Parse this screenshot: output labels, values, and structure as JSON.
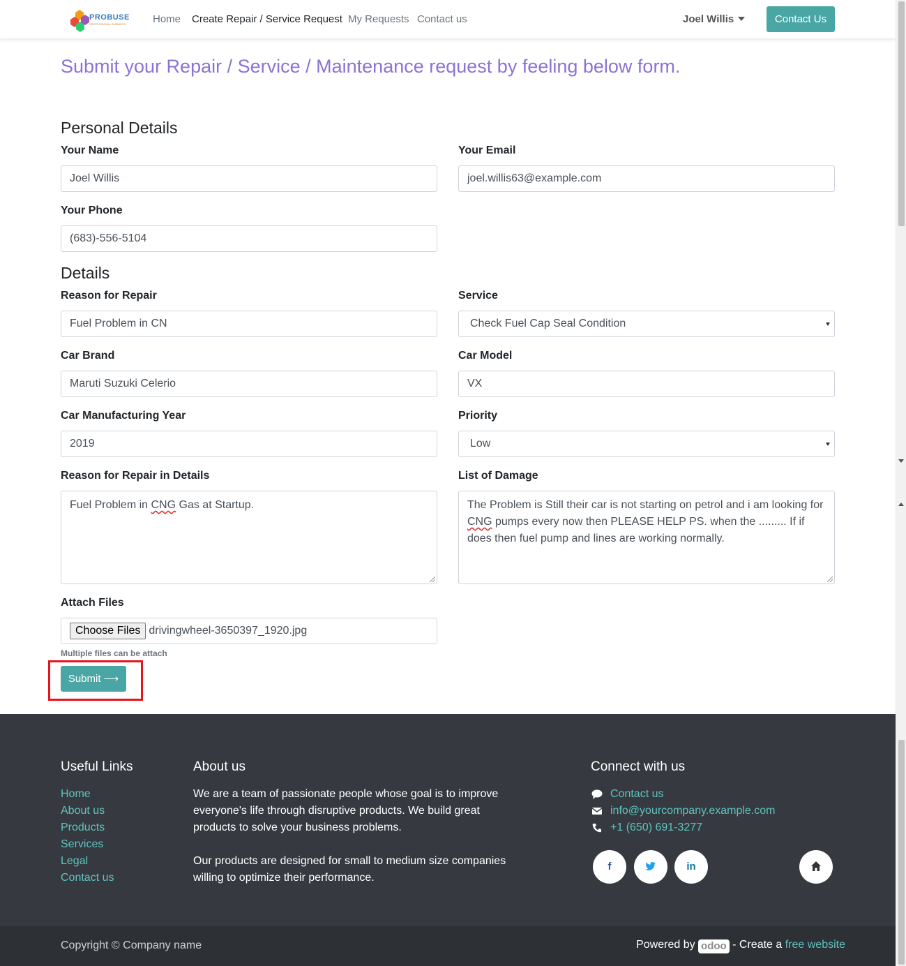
{
  "header": {
    "brand": "PROBUSE",
    "brand_tagline": "PROFESSIONAL BUSINESS",
    "nav": [
      "Home",
      "Create Repair / Service Request",
      "My Requests",
      "Contact us"
    ],
    "user_name": "Joel Willis",
    "contact_button": "Contact Us"
  },
  "main": {
    "title": "Submit your Repair / Service / Maintenance request by feeling below form.",
    "personal_section": "Personal Details",
    "details_section": "Details",
    "fields": {
      "name": {
        "label": "Your Name",
        "value": "Joel Willis"
      },
      "email": {
        "label": "Your Email",
        "value": "joel.willis63@example.com"
      },
      "phone": {
        "label": "Your Phone",
        "value": "(683)-556-5104"
      },
      "reason": {
        "label": "Reason for Repair",
        "value": "Fuel Problem in CN"
      },
      "service": {
        "label": "Service",
        "value": "Check Fuel Cap Seal Condition"
      },
      "brand": {
        "label": "Car Brand",
        "value": "Maruti Suzuki Celerio"
      },
      "model": {
        "label": "Car Model",
        "value": "VX"
      },
      "year": {
        "label": "Car Manufacturing Year",
        "value": "2019"
      },
      "priority": {
        "label": "Priority",
        "value": "Low"
      },
      "reason_details": {
        "label": "Reason for Repair in Details",
        "text_before": "Fuel Problem in ",
        "misspelled": "CNG",
        "text_after": " Gas at Startup."
      },
      "damage": {
        "label": "List of Damage",
        "text_before": "The Problem is Still their car is not starting on petrol and i am looking for ",
        "misspelled": "CNG",
        "text_after": " pumps every now then PLEASE HELP PS. when the ......... If if does then fuel pump and lines are working normally."
      },
      "attach": {
        "label": "Attach Files",
        "button": "Choose Files",
        "file": "drivingwheel-3650397_1920.jpg",
        "help": "Multiple files can be attach"
      }
    },
    "submit_label": "Submit",
    "submit_arrow": "⟶"
  },
  "footer": {
    "useful_links_title": "Useful Links",
    "useful_links": [
      "Home",
      "About us",
      "Products",
      "Services",
      "Legal",
      "Contact us"
    ],
    "about_title": "About us",
    "about_p1": "We are a team of passionate people whose goal is to improve everyone's life through disruptive products. We build great products to solve your business problems.",
    "about_p2": "Our products are designed for small to medium size companies willing to optimize their performance.",
    "connect_title": "Connect with us",
    "contact_link": "Contact us",
    "email": "info@yourcompany.example.com",
    "phone": "+1 (650) 691-3277",
    "social": {
      "facebook": "f",
      "twitter": "t",
      "linkedin": "in"
    },
    "copyright": "Copyright © Company name",
    "powered_by": "Powered by",
    "odoo": "odoo",
    "create_a": " - Create a ",
    "free_website": "free website"
  },
  "colors": {
    "accent": "#49a6a5",
    "title": "#8b72d6",
    "link": "#5ec3c0",
    "footer_bg": "#363a40",
    "highlight": "#e8141a"
  }
}
